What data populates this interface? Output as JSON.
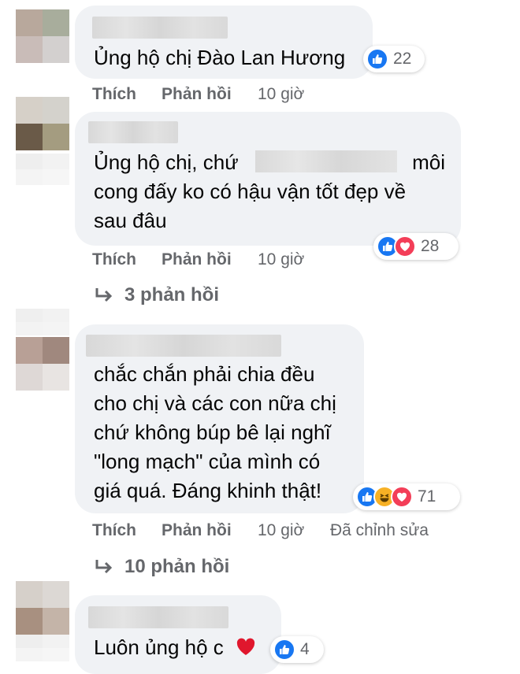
{
  "comments": [
    {
      "text_lines": [
        "Ủng hộ chị Đào Lan Hương"
      ],
      "reaction_count": "22",
      "actions": {
        "like": "Thích",
        "reply": "Phản hồi",
        "time": "10 giờ"
      }
    },
    {
      "text_prefix": "Ủng hộ chị, chứ",
      "text_suffix": "môi",
      "text_lines": [
        "cong đấy ko có hậu vận tốt đẹp về",
        "sau đâu"
      ],
      "reaction_count": "28",
      "actions": {
        "like": "Thích",
        "reply": "Phản hồi",
        "time": "10 giờ"
      },
      "replies_label": "3 phản hồi"
    },
    {
      "text_lines": [
        "chắc chắn phải chia đều",
        "cho chị và các con nữa chị",
        "chứ không búp bê lại nghĩ",
        "\"long mạch\" của mình có",
        "giá quá. Đáng khinh thật!"
      ],
      "reaction_count": "71",
      "actions": {
        "like": "Thích",
        "reply": "Phản hồi",
        "time": "10 giờ",
        "edited": "Đã chỉnh sửa"
      },
      "replies_label": "10 phản hồi"
    },
    {
      "text_lines": [
        "Luôn ủng hộ c"
      ],
      "reaction_count": "4"
    }
  ],
  "colors": {
    "bubble": "#f0f2f5",
    "like": "#1877f2",
    "love": "#f33e58",
    "haha": "#f7b125",
    "secondary_text": "#65676b"
  },
  "icons": [
    "like-icon",
    "love-icon",
    "haha-icon",
    "reply-arrow-icon",
    "heart-emoji-icon"
  ]
}
